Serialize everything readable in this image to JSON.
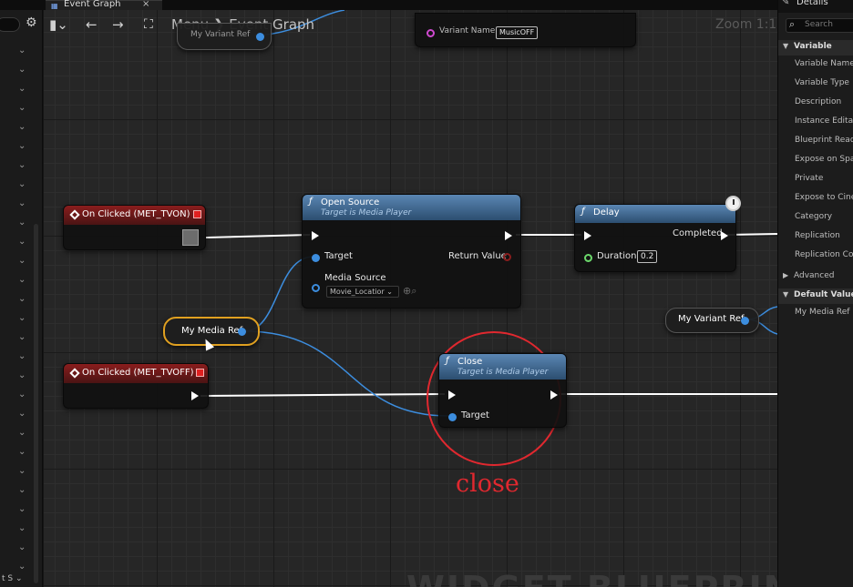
{
  "tab": {
    "label": "Event Graph",
    "close": "×"
  },
  "toolbar": {
    "breadcrumb": "Menu ❯ Event Graph",
    "zoom": "Zoom 1:1"
  },
  "top_partial": {
    "var_ref": "My Variant Ref",
    "variant_label": "Variant Name",
    "variant_value": "MusicOFF"
  },
  "nodes": {
    "on_clicked_on": {
      "title": "On Clicked (MET_TVON)"
    },
    "on_clicked_off": {
      "title": "On Clicked (MET_TVOFF)"
    },
    "open_source": {
      "title": "Open Source",
      "subtitle": "Target is Media Player",
      "target_label": "Target",
      "return_label": "Return Value",
      "media_source_label": "Media Source",
      "media_source_value": "Movie_Locatior ⌄"
    },
    "delay": {
      "title": "Delay",
      "completed_label": "Completed",
      "duration_label": "Duration",
      "duration_value": "0.2"
    },
    "close": {
      "title": "Close",
      "subtitle": "Target is Media Player",
      "target_label": "Target"
    },
    "my_media_ref": {
      "label": "My Media Ref"
    },
    "my_variant_ref": {
      "label": "My Variant Ref"
    }
  },
  "annotation": {
    "text": "close"
  },
  "watermark": {
    "text": "WIDGET BLUEPRINT"
  },
  "left_panel": {
    "bottom_text": "t S ⌄"
  },
  "details": {
    "title": "Details",
    "search_placeholder": "Search",
    "sections": [
      {
        "label": "Variable",
        "items": [
          "Variable Name",
          "Variable Type",
          "Description",
          "Instance Editable",
          "Blueprint Read O",
          "Expose on Spawn",
          "Private",
          "Expose to Cinem",
          "Category",
          "Replication",
          "Replication Cond"
        ]
      },
      {
        "label": "Advanced",
        "items": []
      },
      {
        "label": "Default Value",
        "items": [
          "My Media Ref"
        ]
      }
    ]
  },
  "colors": {
    "event_header": "#8a1d1d",
    "function_header": "#5a86b3",
    "object_pin": "#3c8dde",
    "float_pin": "#6bd86b",
    "selection": "#e0a020",
    "annotation": "#e0282f"
  }
}
